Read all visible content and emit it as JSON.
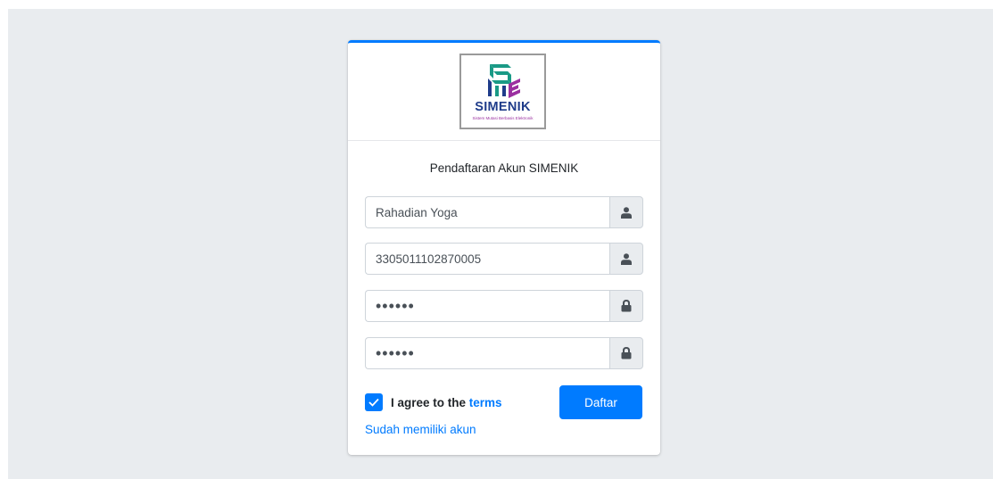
{
  "logo": {
    "title": "SIMENIK",
    "subtitle": "Sistem Mutasi Berbasis Elektronik",
    "mark_colors": {
      "teal": "#1a9a86",
      "purple": "#9b2fa0",
      "navy": "#1f3c8a"
    }
  },
  "form": {
    "message": "Pendaftaran Akun SIMENIK",
    "fields": [
      {
        "value": "Rahadian Yoga",
        "type": "text",
        "icon": "user-icon"
      },
      {
        "value": "3305011102870005",
        "type": "text",
        "icon": "user-icon"
      },
      {
        "value": "••••••",
        "type": "password",
        "icon": "lock-icon"
      },
      {
        "value": "••••••",
        "type": "password",
        "icon": "lock-icon"
      }
    ],
    "agree_prefix": "I agree to the ",
    "agree_link": "terms",
    "agree_checked": true,
    "submit_label": "Daftar",
    "login_link": "Sudah memiliki akun"
  },
  "colors": {
    "primary": "#007bff",
    "background": "#e9ecef",
    "addon": "#e9ecef"
  }
}
